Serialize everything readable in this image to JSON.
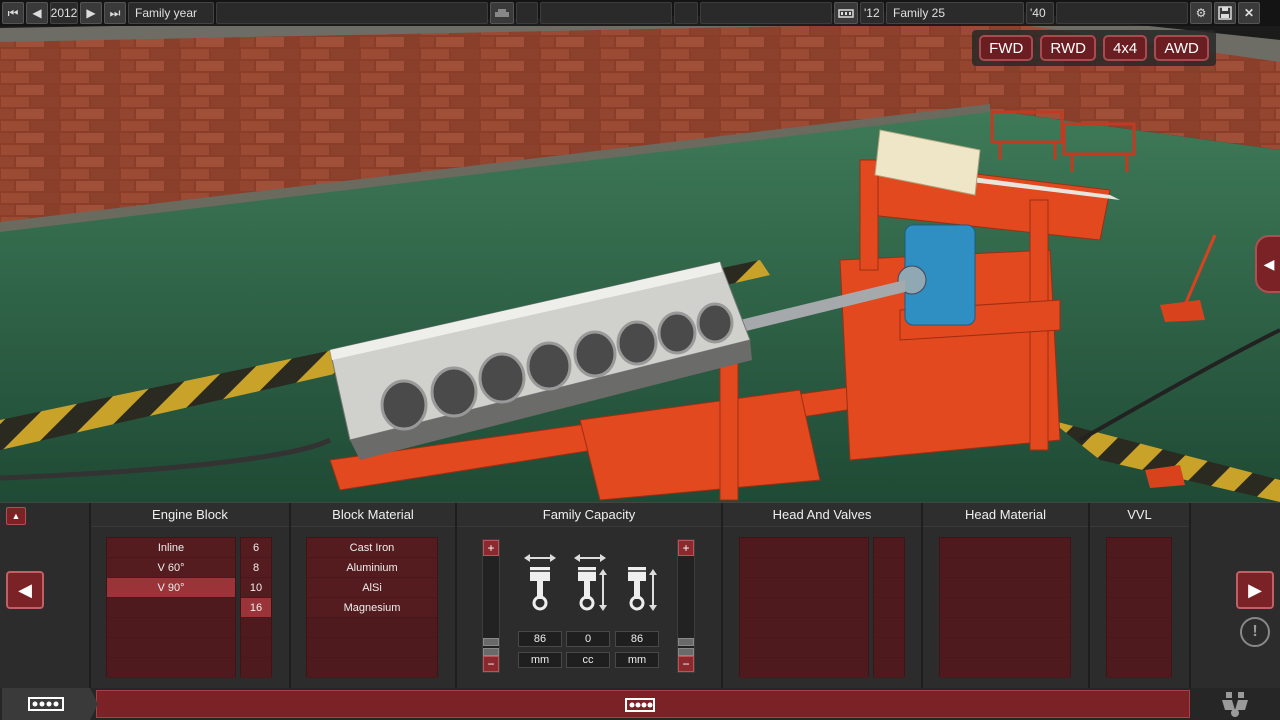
{
  "topbar": {
    "year_value": "2012",
    "year_label": "Family year",
    "family_start": "'12",
    "family_name": "Family 25",
    "family_end": "'40"
  },
  "drivetrain": [
    "FWD",
    "RWD",
    "4x4",
    "AWD"
  ],
  "panel": {
    "engine_block": {
      "title": "Engine Block",
      "layouts": [
        "Inline",
        "V 60°",
        "V 90°"
      ],
      "selected_layout": "V 90°",
      "cylinders": [
        "6",
        "8",
        "10",
        "16"
      ],
      "selected_cylinders": "16"
    },
    "block_material": {
      "title": "Block Material",
      "materials": [
        "Cast Iron",
        "Aluminium",
        "AlSi",
        "Magnesium"
      ]
    },
    "family_capacity": {
      "title": "Family Capacity",
      "bore": "86",
      "capacity": "0",
      "stroke": "86",
      "bore_unit": "mm",
      "capacity_unit": "cc",
      "stroke_unit": "mm"
    },
    "head_and_valves": {
      "title": "Head And Valves"
    },
    "head_material": {
      "title": "Head Material"
    },
    "vvl": {
      "title": "VVL"
    }
  },
  "colors": {
    "accent": "#7a2226",
    "list_bg": "#551c1f",
    "selected": "#9a3438",
    "panel_bg": "#2c2c2c"
  }
}
